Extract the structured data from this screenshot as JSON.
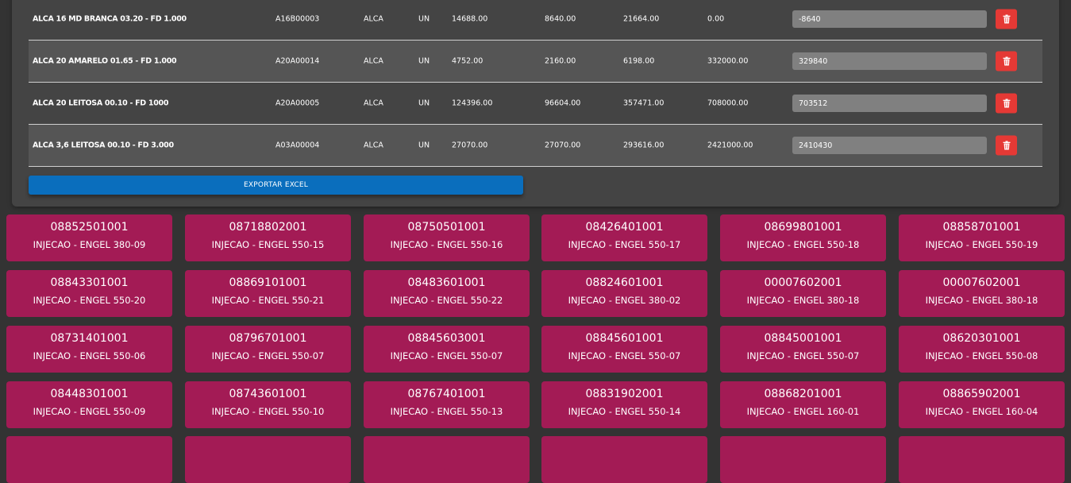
{
  "table": {
    "rows": [
      {
        "descricao": "ALCA 16 MD BRANCA 03.20 - FD 1.000",
        "codigo": "A16B00003",
        "tipo": "ALCA",
        "unidade": "UN",
        "v1": "14688.00",
        "v2": "8640.00",
        "v3": "21664.00",
        "v4": "0.00",
        "input": "-8640"
      },
      {
        "descricao": "ALCA 20 AMARELO 01.65 - FD 1.000",
        "codigo": "A20A00014",
        "tipo": "ALCA",
        "unidade": "UN",
        "v1": "4752.00",
        "v2": "2160.00",
        "v3": "6198.00",
        "v4": "332000.00",
        "input": "329840"
      },
      {
        "descricao": "ALCA 20 LEITOSA 00.10 - FD 1000",
        "codigo": "A20A00005",
        "tipo": "ALCA",
        "unidade": "UN",
        "v1": "124396.00",
        "v2": "96604.00",
        "v3": "357471.00",
        "v4": "708000.00",
        "input": "703512"
      },
      {
        "descricao": "ALCA 3,6 LEITOSA 00.10 - FD 3.000",
        "codigo": "A03A00004",
        "tipo": "ALCA",
        "unidade": "UN",
        "v1": "27070.00",
        "v2": "27070.00",
        "v3": "293616.00",
        "v4": "2421000.00",
        "input": "2410430"
      }
    ],
    "delete_icon": "trash-icon",
    "export_label": "EXPORTAR EXCEL"
  },
  "cards": [
    {
      "code": "08852501001",
      "machine": "INJECAO - ENGEL 380-09"
    },
    {
      "code": "08718802001",
      "machine": "INJECAO - ENGEL 550-15"
    },
    {
      "code": "08750501001",
      "machine": "INJECAO - ENGEL 550-16"
    },
    {
      "code": "08426401001",
      "machine": "INJECAO - ENGEL 550-17"
    },
    {
      "code": "08699801001",
      "machine": "INJECAO - ENGEL 550-18"
    },
    {
      "code": "08858701001",
      "machine": "INJECAO - ENGEL 550-19"
    },
    {
      "code": "08843301001",
      "machine": "INJECAO - ENGEL 550-20"
    },
    {
      "code": "08869101001",
      "machine": "INJECAO - ENGEL 550-21"
    },
    {
      "code": "08483601001",
      "machine": "INJECAO - ENGEL 550-22"
    },
    {
      "code": "08824601001",
      "machine": "INJECAO - ENGEL 380-02"
    },
    {
      "code": "00007602001",
      "machine": "INJECAO - ENGEL 380-18"
    },
    {
      "code": "00007602001",
      "machine": "INJECAO - ENGEL 380-18"
    },
    {
      "code": "08731401001",
      "machine": "INJECAO - ENGEL 550-06"
    },
    {
      "code": "08796701001",
      "machine": "INJECAO - ENGEL 550-07"
    },
    {
      "code": "08845603001",
      "machine": "INJECAO - ENGEL 550-07"
    },
    {
      "code": "08845601001",
      "machine": "INJECAO - ENGEL 550-07"
    },
    {
      "code": "08845001001",
      "machine": "INJECAO - ENGEL 550-07"
    },
    {
      "code": "08620301001",
      "machine": "INJECAO - ENGEL 550-08"
    },
    {
      "code": "08448301001",
      "machine": "INJECAO - ENGEL 550-09"
    },
    {
      "code": "08743601001",
      "machine": "INJECAO - ENGEL 550-10"
    },
    {
      "code": "08767401001",
      "machine": "INJECAO - ENGEL 550-13"
    },
    {
      "code": "08831902001",
      "machine": "INJECAO - ENGEL 550-14"
    },
    {
      "code": "08868201001",
      "machine": "INJECAO - ENGEL 160-01"
    },
    {
      "code": "08865902001",
      "machine": "INJECAO - ENGEL 160-04"
    },
    {
      "code": "",
      "machine": ""
    },
    {
      "code": "",
      "machine": ""
    },
    {
      "code": "",
      "machine": ""
    },
    {
      "code": "",
      "machine": ""
    },
    {
      "code": "",
      "machine": ""
    },
    {
      "code": "",
      "machine": ""
    }
  ],
  "colors": {
    "card": "#a31b55",
    "export": "#0a6ebd",
    "delete": "#e53935",
    "panel": "#444444"
  }
}
